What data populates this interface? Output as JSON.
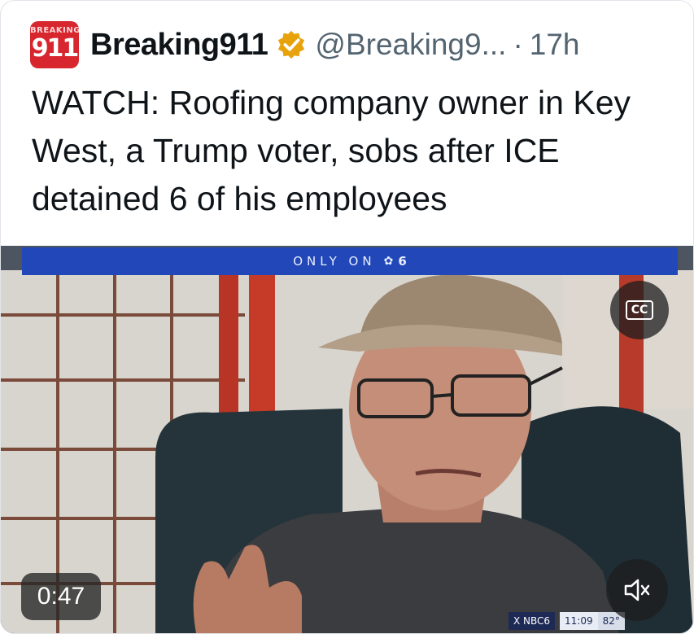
{
  "tweet": {
    "avatar": {
      "tag": "BREAKING",
      "number": "911"
    },
    "display_name": "Breaking911",
    "verified_icon": "gold-verified-badge-icon",
    "handle": "@Breaking9...",
    "separator": "·",
    "time_ago": "17h",
    "text": "WATCH: Roofing company owner in Key West, a Trump voter, sobs after ICE detained 6 of his employees"
  },
  "video": {
    "banner": {
      "label": "ONLY ON",
      "channel": "6"
    },
    "cc_label": "CC",
    "duration": "0:47",
    "ticker": {
      "social": "X NBC6",
      "time": "11:09",
      "temp": "82°"
    },
    "mute_icon": "speaker-muted-icon"
  },
  "colors": {
    "avatar_red": "#d7262e",
    "banner_blue": "#2147b8",
    "verified_gold": "#e8a20c",
    "text": "#0f1419",
    "secondary_text": "#536471"
  }
}
